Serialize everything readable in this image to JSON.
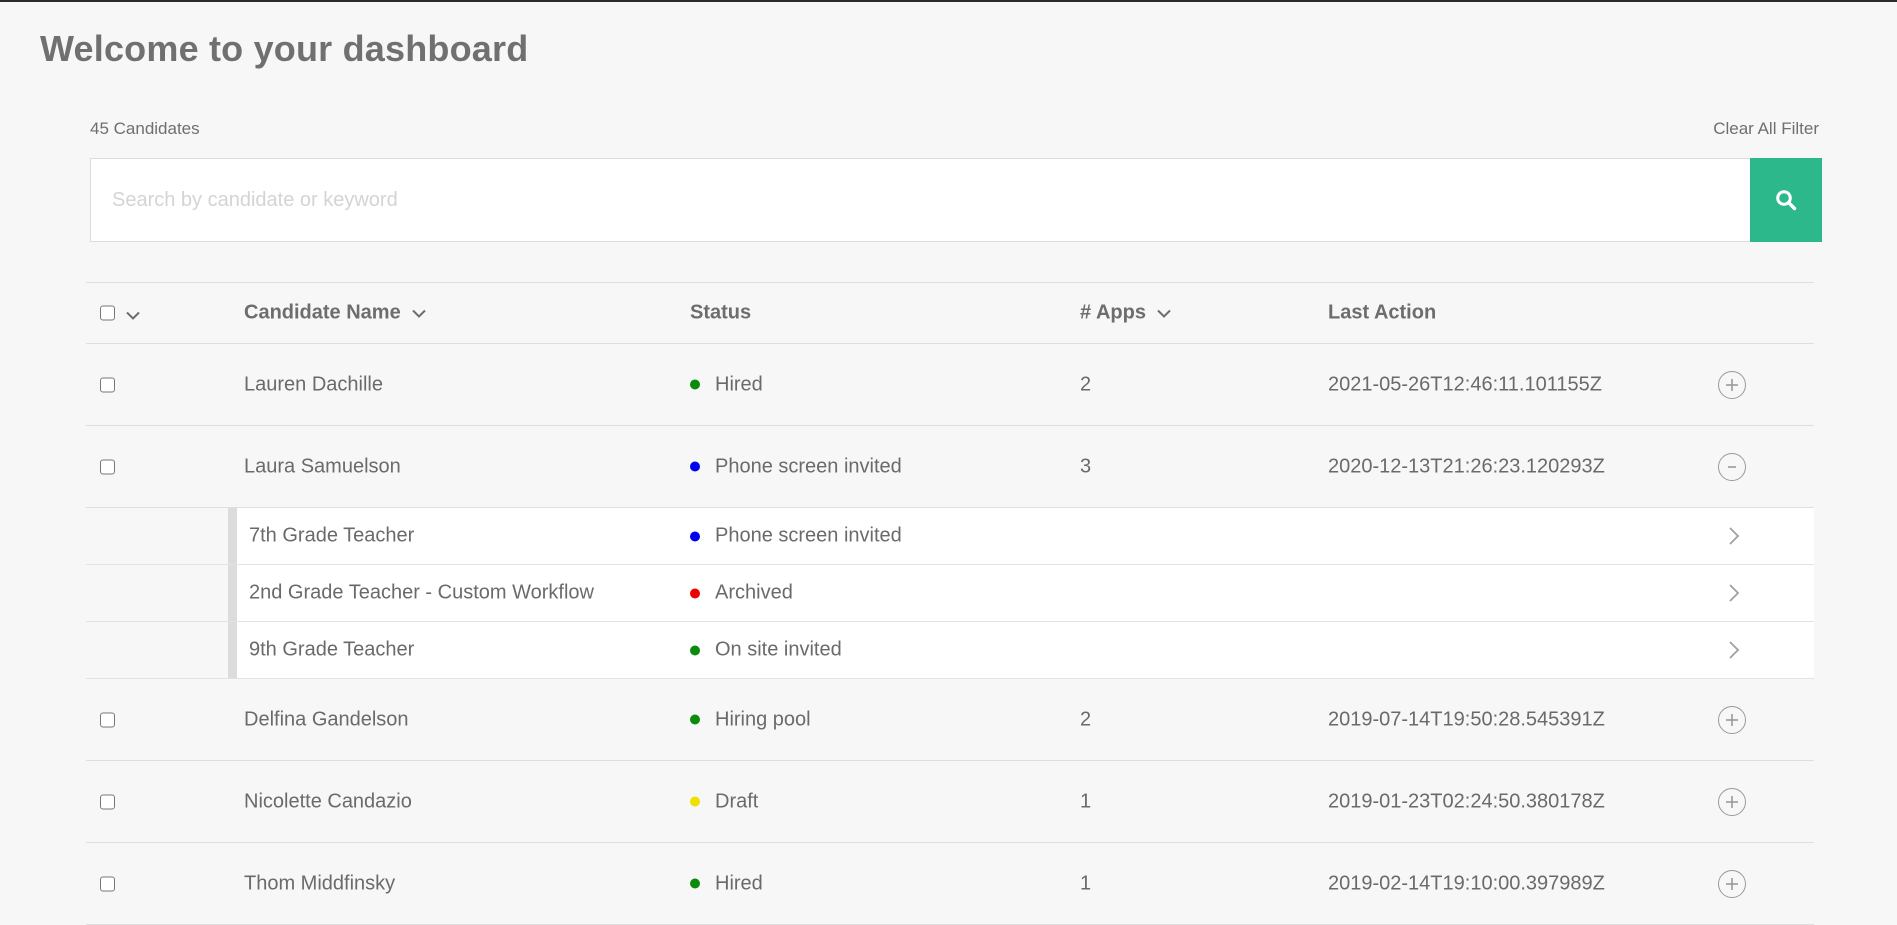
{
  "page": {
    "title": "Welcome to your dashboard",
    "candidate_count": "45 Candidates",
    "clear_filter": "Clear All Filter"
  },
  "search": {
    "placeholder": "Search by candidate or keyword",
    "value": "",
    "button_icon": "search-icon",
    "button_color": "#2db88c"
  },
  "table": {
    "headers": {
      "name": "Candidate Name",
      "status": "Status",
      "apps": "# Apps",
      "last_action": "Last Action"
    },
    "rows": [
      {
        "name": "Lauren Dachille",
        "status": "Hired",
        "status_color": "#0b8a0b",
        "apps": "2",
        "last_action": "2021-05-26T12:46:11.101155Z",
        "action_icon": "plus-circle-icon"
      },
      {
        "name": "Laura Samuelson",
        "status": "Phone screen invited",
        "status_color": "#0000ee",
        "apps": "3",
        "last_action": "2020-12-13T21:26:23.120293Z",
        "action_icon": "minus-circle-icon",
        "applications": [
          {
            "job": "7th Grade Teacher",
            "status": "Phone screen invited",
            "status_color": "#0000ee"
          },
          {
            "job": "2nd Grade Teacher - Custom Workflow",
            "status": "Archived",
            "status_color": "#ee0000"
          },
          {
            "job": "9th Grade Teacher",
            "status": "On site invited",
            "status_color": "#0b8a0b"
          }
        ]
      },
      {
        "name": "Delfina Gandelson",
        "status": "Hiring pool",
        "status_color": "#0b8a0b",
        "apps": "2",
        "last_action": "2019-07-14T19:50:28.545391Z",
        "action_icon": "plus-circle-icon"
      },
      {
        "name": "Nicolette Candazio",
        "status": "Draft",
        "status_color": "#f0e000",
        "apps": "1",
        "last_action": "2019-01-23T02:24:50.380178Z",
        "action_icon": "plus-circle-icon"
      },
      {
        "name": "Thom Middfinsky",
        "status": "Hired",
        "status_color": "#0b8a0b",
        "apps": "1",
        "last_action": "2019-02-14T19:10:00.397989Z",
        "action_icon": "plus-circle-icon"
      }
    ]
  }
}
